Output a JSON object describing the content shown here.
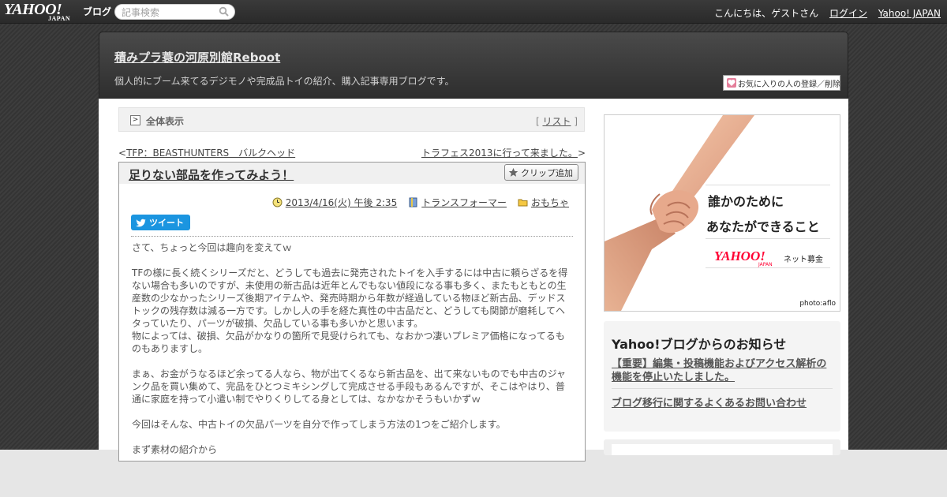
{
  "topbar": {
    "logo_yahoo": "YAHOO!",
    "logo_japan": "JAPAN",
    "logo_blog": "ブログ",
    "search_placeholder": "記事検索",
    "greeting": "こんにちは、ゲストさん",
    "login": "ログイン",
    "yahoo_japan": "Yahoo! JAPAN"
  },
  "header": {
    "title": "積みプラ蓑の河原別館Reboot",
    "description": "個人的にブーム来てるデジモノや完成品トイの紹介、購入記事専用ブログです。",
    "favorite_button": "お気に入りの人の登録／削除"
  },
  "nav": {
    "show_all": "全体表示",
    "list_open": "[ ",
    "list": "リスト",
    "list_close": " ]"
  },
  "prevnext": {
    "prev_arrow": "<",
    "prev": "TFP：BEASTHUNTERS　バルクヘッド",
    "next": "トラフェス2013に行って来ました。",
    "next_arrow": ">"
  },
  "article": {
    "title": "足りない部品を作ってみよう！",
    "clip_button": "クリップ追加",
    "date": "2013/4/16(火) 午後 2:35",
    "category1": "トランスフォーマー",
    "category2": "おもちゃ",
    "tweet": "ツイート",
    "paragraphs": [
      "さて、ちょっと今回は趣向を変えてｗ",
      "",
      "TFの様に長く続くシリーズだと、どうしても過去に発売されたトイを入手するには中古に頼らざるを得ない場合も多いのですが、未使用の新古品は近年とんでもない値段になる事も多く、またもともとの生産数の少なかったシリーズ後期アイテムや、発売時期から年数が経過している物ほど新古品、デッドストックの残存数は減る一方です。しかし人の手を経た真性の中古品だと、どうしても関節が磨耗してヘタっていたり、パーツが破損、欠品している事も多いかと思います。",
      "物によっては、破損、欠品がかなりの箇所で見受けられても、なおかつ凄いプレミア価格になってるものもありますし。",
      "",
      "まぁ、お金がうなるほど余ってる人なら、物が出てくるなら新古品を、出て来ないものでも中古のジャンク品を買い集めて、完品をひとつミキシングして完成させる手段もあるんですが、そこはやはり、普通に家庭を持って小遣い制でやりくりしてる身としては、なかなかそうもいかずｗ",
      "",
      "今回はそんな、中古トイの欠品パーツを自分で作ってしまう方法の1つをご紹介します。",
      "",
      "まず素材の紹介から"
    ]
  },
  "ad": {
    "copy_line1": "誰かのために",
    "copy_line2": "あなたができること",
    "logo": "YAHOO!",
    "logo_japan": "JAPAN",
    "fund": "ネット募金",
    "photo_credit": "photo:aflo"
  },
  "notice": {
    "heading": "Yahoo!ブログからのお知らせ",
    "item1": "【重要】編集・投稿機能およびアクセス解析の機能を停止いたしました。",
    "item2": "ブログ移行に関するよくあるお問い合わせ"
  },
  "colors": {
    "tweet_blue": "#1b95e0",
    "yahoo_red": "#ff0033"
  }
}
